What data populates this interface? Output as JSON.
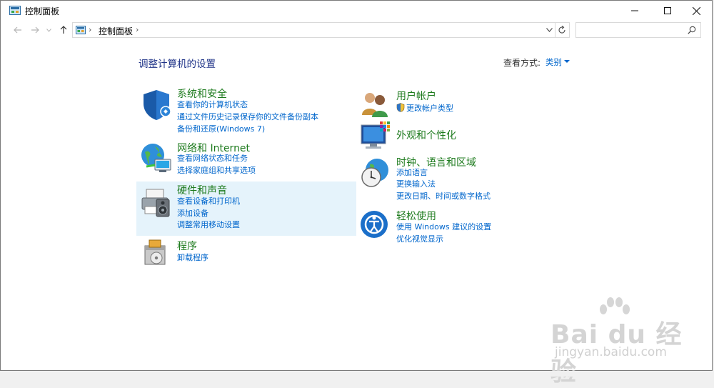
{
  "window": {
    "title": "控制面板",
    "icon": "control-panel-icon",
    "controls": {
      "minimize": "minimize-icon",
      "maximize": "maximize-icon",
      "close": "close-icon"
    }
  },
  "nav": {
    "back_icon": "arrow-left-icon",
    "forward_icon": "arrow-right-icon",
    "recent_icon": "chevron-down-icon",
    "up_icon": "arrow-up-icon",
    "breadcrumb_sep": "›",
    "breadcrumb": "控制面板",
    "refresh_icon": "refresh-icon",
    "search_placeholder": "",
    "search_icon": "search-icon"
  },
  "header": {
    "page_title": "调整计算机的设置",
    "view_by_label": "查看方式:",
    "view_by_value": "类别"
  },
  "categories_left": [
    {
      "title": "系统和安全",
      "icon": "shield-icon",
      "links": [
        "查看你的计算机状态",
        "通过文件历史记录保存你的文件备份副本",
        "备份和还原(Windows 7)"
      ]
    },
    {
      "title": "网络和 Internet",
      "icon": "globe-network-icon",
      "links": [
        "查看网络状态和任务",
        "选择家庭组和共享选项"
      ]
    },
    {
      "title": "硬件和声音",
      "icon": "printer-speaker-icon",
      "links": [
        "查看设备和打印机",
        "添加设备",
        "调整常用移动设置"
      ]
    },
    {
      "title": "程序",
      "icon": "programs-disc-icon",
      "links": [
        "卸载程序"
      ]
    }
  ],
  "categories_right": [
    {
      "title": "用户帐户",
      "icon": "users-icon",
      "links": [
        "更改帐户类型"
      ],
      "link_icon": "uac-shield-icon"
    },
    {
      "title": "外观和个性化",
      "icon": "monitor-palette-icon",
      "links": []
    },
    {
      "title": "时钟、语言和区域",
      "icon": "clock-globe-icon",
      "links": [
        "添加语言",
        "更换输入法",
        "更改日期、时间或数字格式"
      ]
    },
    {
      "title": "轻松使用",
      "icon": "ease-of-access-icon",
      "links": [
        "使用 Windows 建议的设置",
        "优化视觉显示"
      ]
    }
  ],
  "watermark": {
    "main": "Bai du 经验",
    "sub": "jingyan.baidu.com"
  },
  "colors": {
    "title_green": "#1e7b1e",
    "link_blue": "#0066cc",
    "highlight": "#e5f3fb",
    "header_blue": "#1e3287"
  }
}
